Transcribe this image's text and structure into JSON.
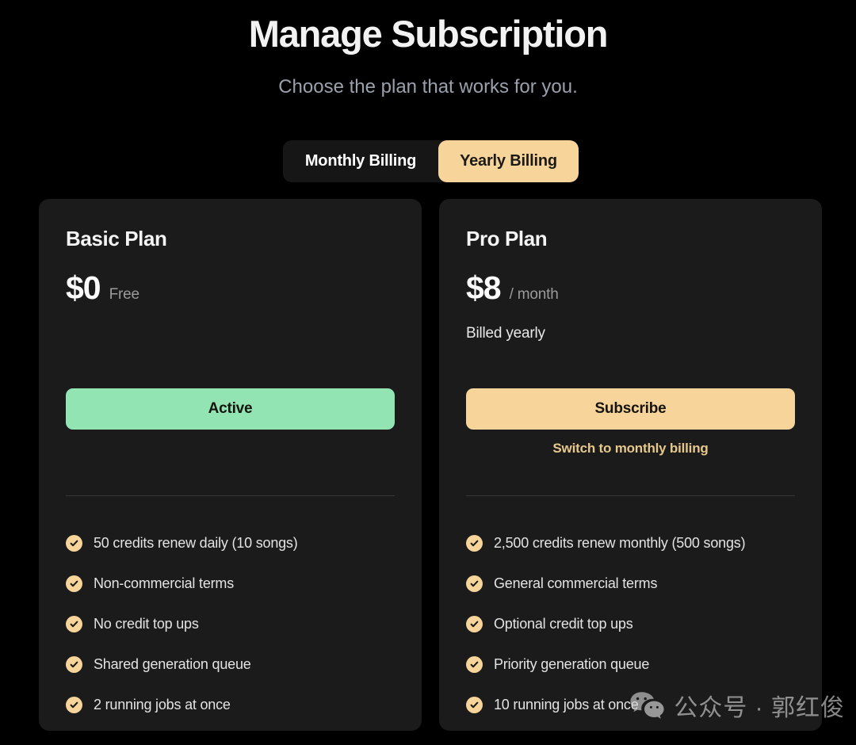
{
  "header": {
    "title": "Manage Subscription",
    "subtitle": "Choose the plan that works for you."
  },
  "billing_toggle": {
    "monthly_label": "Monthly Billing",
    "yearly_label": "Yearly Billing",
    "selected": "yearly",
    "active_bg": "#f7d49a",
    "active_text": "#1c1a16",
    "container_bg": "#161616"
  },
  "plans": [
    {
      "name": "Basic Plan",
      "price": "$0",
      "price_suffix": "Free",
      "billed_note": "",
      "cta_label": "Active",
      "cta_color": "#93e4b3",
      "cta_state": "active",
      "switch_link": "",
      "features": [
        "50 credits renew daily (10 songs)",
        "Non-commercial terms",
        "No credit top ups",
        "Shared generation queue",
        "2 running jobs at once"
      ]
    },
    {
      "name": "Pro Plan",
      "price": "$8",
      "price_suffix": "/ month",
      "billed_note": "Billed yearly",
      "cta_label": "Subscribe",
      "cta_color": "#f7d49a",
      "cta_state": "subscribe",
      "switch_link": "Switch to monthly billing",
      "features": [
        "2,500 credits renew monthly (500 songs)",
        "General commercial terms",
        "Optional credit top ups",
        "Priority generation queue",
        "10 running jobs at once"
      ]
    }
  ],
  "watermark": {
    "text": "公众号 · 郭红俊",
    "icon": "wechat-icon"
  },
  "theme": {
    "page_bg": "#000000",
    "card_bg": "#1b1b1b",
    "accent_tan": "#f7d49a",
    "accent_green": "#93e4b3",
    "accent_gold": "#e7c88c",
    "text_primary": "#f2f2f2",
    "text_muted": "#9aa1ad"
  }
}
